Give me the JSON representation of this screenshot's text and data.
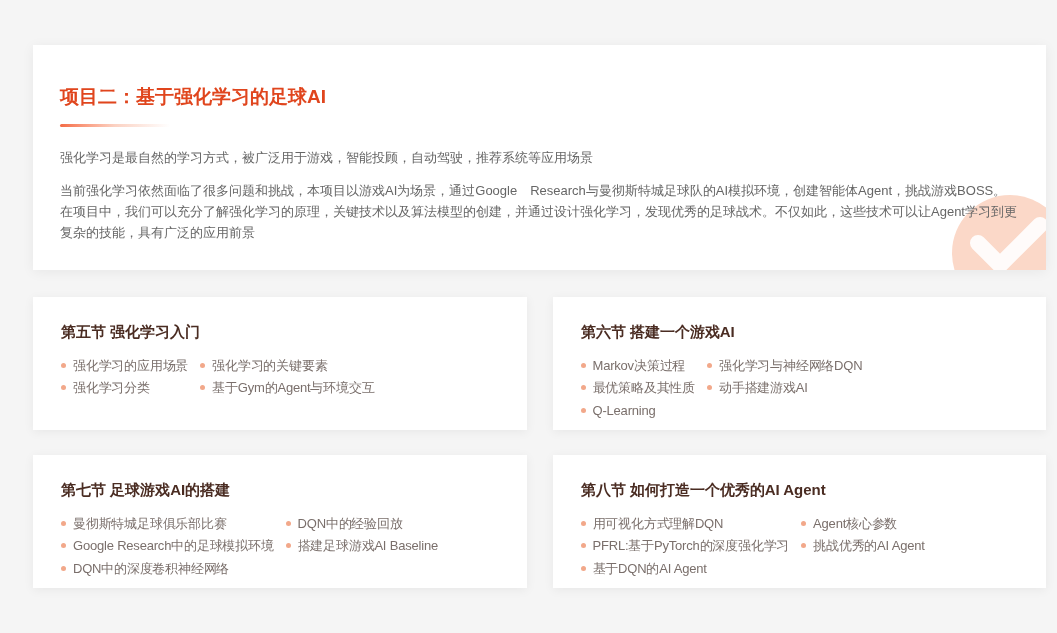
{
  "project": {
    "title": "项目二：基于强化学习的足球AI",
    "paragraphs": [
      "强化学习是最自然的学习方式，被广泛用于游戏，智能投顾，自动驾驶，推荐系统等应用场景",
      "当前强化学习依然面临了很多问题和挑战，本项目以游戏AI为场景，通过Google　Research与曼彻斯特城足球队的AI模拟环境，创建智能体Agent，挑战游戏BOSS。在项目中，我们可以充分了解强化学习的原理，关键技术以及算法模型的创建，并通过设计强化学习，发现优秀的足球战术。不仅如此，这些技术可以让Agent学习到更复杂的技能，具有广泛的应用前景"
    ]
  },
  "sections": [
    {
      "title": "第五节 强化学习入门",
      "items": [
        "强化学习的应用场景",
        "强化学习的关键要素",
        "强化学习分类",
        "基于Gym的Agent与环境交互"
      ]
    },
    {
      "title": "第六节 搭建一个游戏AI",
      "items": [
        "Markov决策过程",
        "强化学习与神经网络DQN",
        "最优策略及其性质",
        "动手搭建游戏AI",
        "Q-Learning"
      ]
    },
    {
      "title": "第七节 足球游戏AI的搭建",
      "items": [
        "曼彻斯特城足球俱乐部比赛",
        "DQN中的经验回放",
        "Google Research中的足球模拟环境",
        "搭建足球游戏AI Baseline",
        "DQN中的深度卷积神经网络"
      ]
    },
    {
      "title": "第八节 如何打造一个优秀的AI Agent",
      "items": [
        "用可视化方式理解DQN",
        "Agent核心参数",
        "PFRL:基于PyTorch的深度强化学习",
        "挑战优秀的AI Agent",
        "基于DQN的AI Agent"
      ]
    }
  ]
}
